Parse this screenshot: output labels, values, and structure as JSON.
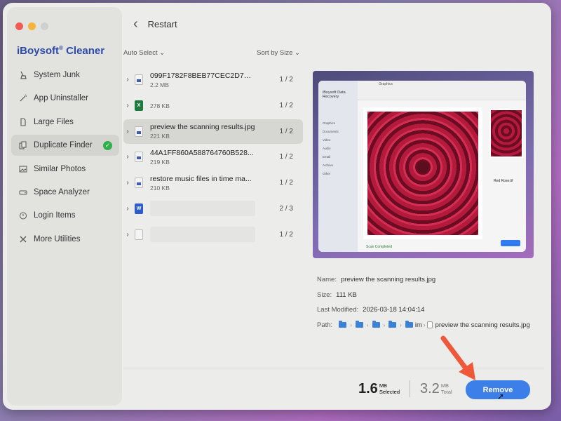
{
  "app": {
    "name": "iBoysoft",
    "registered": "®",
    "name_suffix": " Cleaner"
  },
  "window": {
    "traffic_lights": [
      "#f25a55",
      "#f6b43a",
      "#d0d0d0"
    ]
  },
  "sidebar": {
    "items": [
      {
        "label": "System Junk",
        "icon": "broom-icon"
      },
      {
        "label": "App Uninstaller",
        "icon": "wand-icon"
      },
      {
        "label": "Large Files",
        "icon": "file-icon"
      },
      {
        "label": "Duplicate Finder",
        "icon": "duplicate-icon",
        "active": true,
        "badge": "✓"
      },
      {
        "label": "Similar Photos",
        "icon": "photo-icon"
      },
      {
        "label": "Space Analyzer",
        "icon": "drive-icon"
      },
      {
        "label": "Login Items",
        "icon": "power-icon"
      },
      {
        "label": "More Utilities",
        "icon": "tools-icon"
      }
    ]
  },
  "header": {
    "back_icon": "‹",
    "title": "Restart"
  },
  "list_controls": {
    "auto_select": "Auto Select ⌄",
    "sort": "Sort by Size ⌄"
  },
  "files": [
    {
      "name": "099F1782F8BEB77CEC2D7BB...",
      "size": "2.2 MB",
      "count": "1 / 2",
      "icon": "file"
    },
    {
      "name": "",
      "size": "278 KB",
      "count": "1 / 2",
      "icon": "xls"
    },
    {
      "name": "preview the scanning results.jpg",
      "size": "221 KB",
      "count": "1 / 2",
      "icon": "file",
      "selected": true
    },
    {
      "name": "44A1FF860A588764760B528...",
      "size": "219 KB",
      "count": "1 / 2",
      "icon": "file"
    },
    {
      "name": "restore music files in time ma...",
      "size": "210 KB",
      "count": "1 / 2",
      "icon": "file"
    },
    {
      "name": "",
      "size": "",
      "count": "2 / 3",
      "icon": "doc",
      "blurred": true
    },
    {
      "name": "",
      "size": "",
      "count": "1 / 2",
      "icon": "blank",
      "blurred": true
    }
  ],
  "preview_image": {
    "app_title": "iBoysoft Data Recovery",
    "tab": "Graphics",
    "sidebar_items": [
      "Graphics",
      "Documents",
      "Video",
      "Audio",
      "Email",
      "Archive",
      "Other"
    ],
    "thumb_name": "Red Rose.tif",
    "status": "Scan Completed"
  },
  "info": {
    "name_label": "Name:",
    "name_value": "preview the scanning results.jpg",
    "size_label": "Size:",
    "size_value": "111 KB",
    "modified_label": "Last Modified:",
    "modified_value": "2026-03-18 14:04:14",
    "path_label": "Path:",
    "path_partial": "im",
    "path_file": "preview the scanning results.jpg"
  },
  "footer": {
    "selected_value": "1.6",
    "selected_unit": "MB",
    "selected_label": "Selected",
    "total_value": "3.2",
    "total_unit": "MB",
    "total_label": "Total",
    "remove_label": "Remove"
  },
  "colors": {
    "accent": "#3d7fe8",
    "brand": "#2b4aa8",
    "badge": "#2fb14a",
    "arrow": "#f0583a"
  }
}
